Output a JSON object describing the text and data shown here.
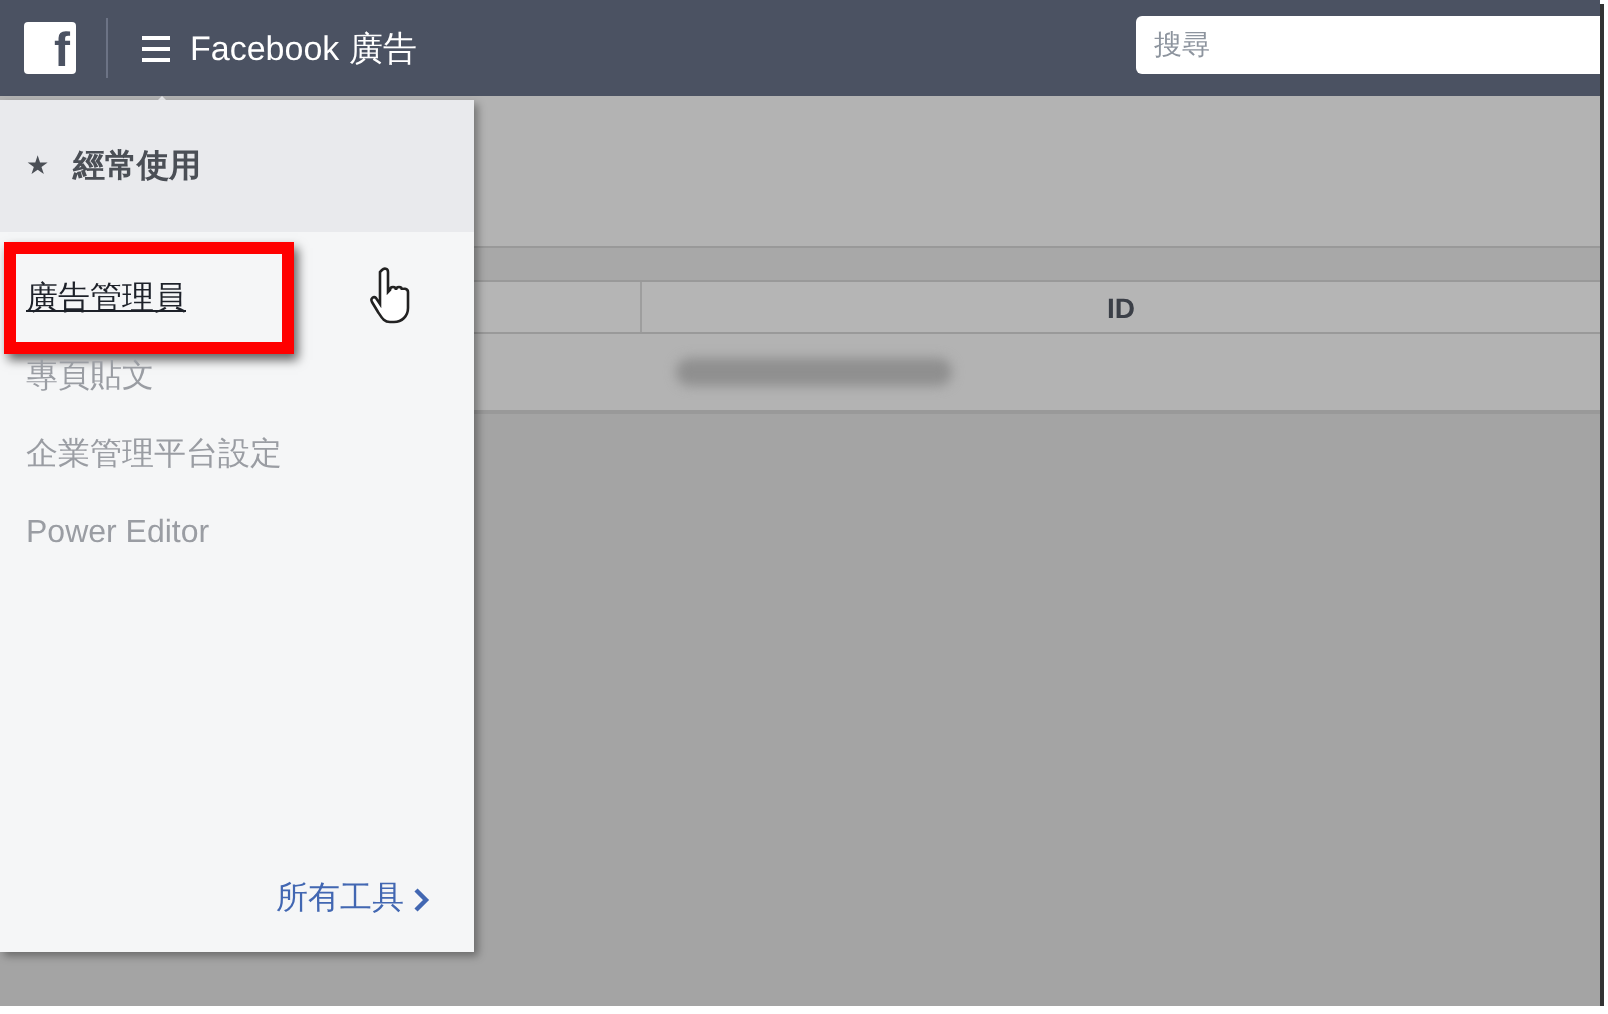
{
  "topbar": {
    "logo": "f",
    "title": "Facebook 廣告",
    "search": {
      "placeholder": "搜尋"
    }
  },
  "menu": {
    "header": {
      "icon": "★",
      "label": "經常使用"
    },
    "items": [
      {
        "label": "廣告管理員",
        "highlighted": true
      },
      {
        "label": "專頁貼文",
        "highlighted": false
      },
      {
        "label": "企業管理平台設定",
        "highlighted": false
      },
      {
        "label": "Power Editor",
        "highlighted": false
      }
    ],
    "footer_link": "所有工具"
  },
  "table": {
    "columns": [
      "ID"
    ]
  }
}
